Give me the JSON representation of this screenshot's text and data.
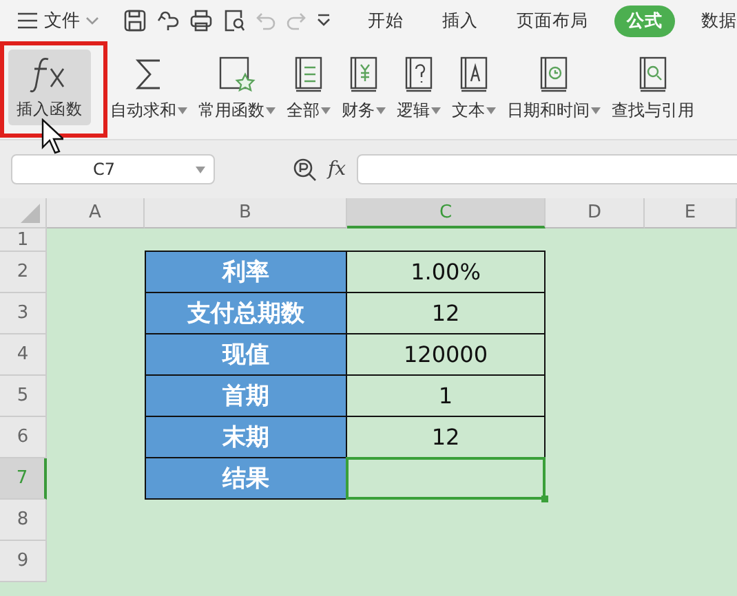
{
  "menu": {
    "label": "文件"
  },
  "tabs": [
    {
      "label": "开始",
      "selected": false
    },
    {
      "label": "插入",
      "selected": false
    },
    {
      "label": "页面布局",
      "selected": false
    },
    {
      "label": "公式",
      "selected": true
    },
    {
      "label": "数据",
      "selected": false
    }
  ],
  "ribbon": [
    {
      "label": "插入函数",
      "dropdown": false,
      "hovered": true
    },
    {
      "label": "自动求和",
      "dropdown": true,
      "hovered": false
    },
    {
      "label": "常用函数",
      "dropdown": true,
      "hovered": false
    },
    {
      "label": "全部",
      "dropdown": true,
      "hovered": false
    },
    {
      "label": "财务",
      "dropdown": true,
      "hovered": false
    },
    {
      "label": "逻辑",
      "dropdown": true,
      "hovered": false
    },
    {
      "label": "文本",
      "dropdown": true,
      "hovered": false
    },
    {
      "label": "日期和时间",
      "dropdown": true,
      "hovered": false
    },
    {
      "label": "查找与引用",
      "dropdown": false,
      "hovered": false
    }
  ],
  "name_box": {
    "value": "C7"
  },
  "formula_bar": {
    "label": "fx"
  },
  "columns": [
    {
      "label": "A",
      "selected": false
    },
    {
      "label": "B",
      "selected": false
    },
    {
      "label": "C",
      "selected": true
    },
    {
      "label": "D",
      "selected": false
    },
    {
      "label": "E",
      "selected": false
    }
  ],
  "rows": [
    {
      "label": "1",
      "selected": false
    },
    {
      "label": "2",
      "selected": false
    },
    {
      "label": "3",
      "selected": false
    },
    {
      "label": "4",
      "selected": false
    },
    {
      "label": "5",
      "selected": false
    },
    {
      "label": "6",
      "selected": false
    },
    {
      "label": "7",
      "selected": true
    },
    {
      "label": "8",
      "selected": false
    },
    {
      "label": "9",
      "selected": false
    }
  ],
  "table": [
    {
      "label": "利率",
      "value": "1.00%",
      "selected": false
    },
    {
      "label": "支付总期数",
      "value": "12",
      "selected": false
    },
    {
      "label": "现值",
      "value": "120000",
      "selected": false
    },
    {
      "label": "首期",
      "value": "1",
      "selected": false
    },
    {
      "label": "末期",
      "value": "12",
      "selected": false
    },
    {
      "label": "结果",
      "selected": true
    }
  ]
}
